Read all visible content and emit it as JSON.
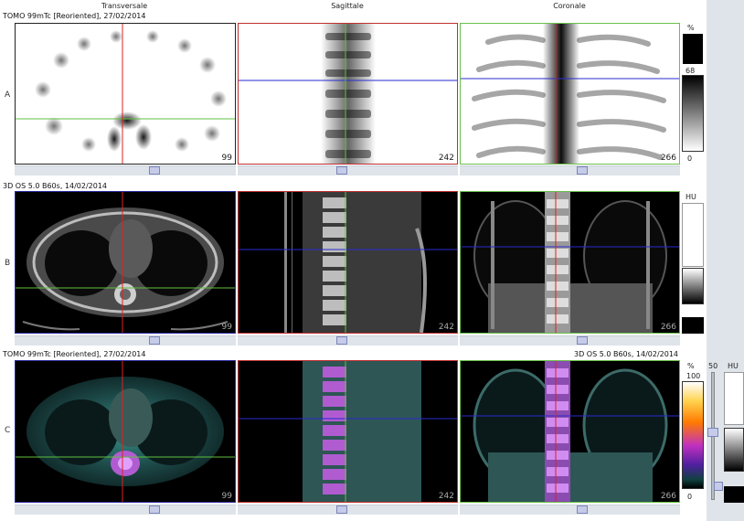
{
  "columns": {
    "transversale": "Transversale",
    "sagittale": "Sagittale",
    "coronale": "Coronale"
  },
  "rows": [
    {
      "label": "A",
      "series": "TOMO 99mTc [Reoriented], 27/02/2014",
      "slices": [
        "99",
        "242",
        "266"
      ]
    },
    {
      "label": "B",
      "series": "3D  OS  5.0  B60s, 14/02/2014",
      "slices": [
        "99",
        "242",
        "266"
      ]
    },
    {
      "label": "C",
      "series": "TOMO 99mTc [Reoriented], 27/02/2014",
      "series_right": "3D  OS  5.0  B60s, 14/02/2014",
      "slices": [
        "99",
        "242",
        "266"
      ]
    }
  ],
  "scales": {
    "a": {
      "unit": "%",
      "max": "68",
      "min": "0"
    },
    "b": {
      "unit": "HU"
    },
    "c": {
      "unit": "%",
      "max": "100",
      "min": "0",
      "fusion": "50",
      "unit2": "HU"
    }
  },
  "colors": {
    "red": "#e02020",
    "green": "#5fc040",
    "blue": "#2a2ad0",
    "frame_a": "#222222",
    "frame_red": "#c03030",
    "frame_green": "#6ac04a",
    "frame_blue": "#2a2aa0"
  }
}
